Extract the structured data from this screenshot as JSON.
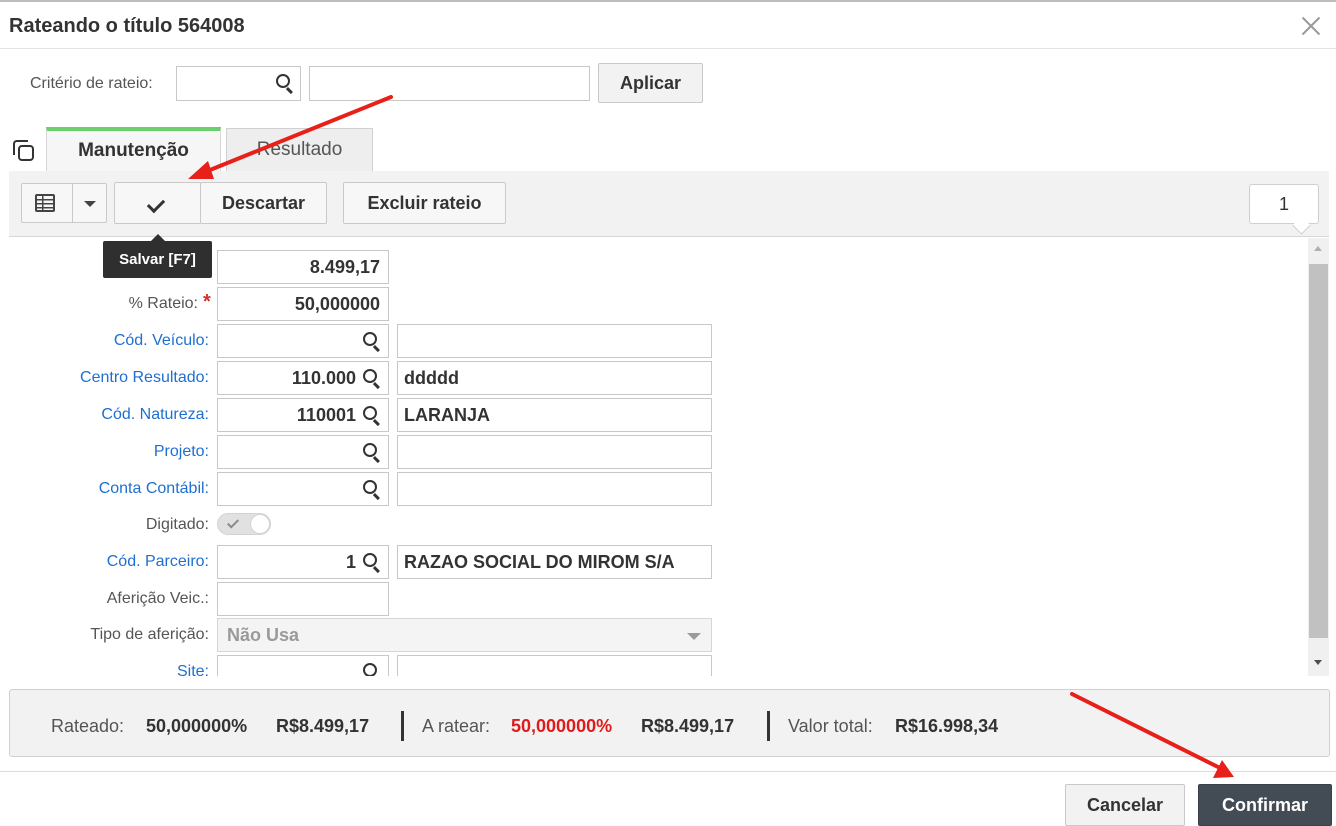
{
  "dialog": {
    "title": "Rateando o título 564008"
  },
  "criterio": {
    "label": "Critério de rateio:",
    "code_value": "",
    "desc_value": "",
    "apply_label": "Aplicar"
  },
  "tabs": [
    {
      "label": "Manutenção",
      "active": true
    },
    {
      "label": "Resultado",
      "active": false
    }
  ],
  "toolbar": {
    "descartar_label": "Descartar",
    "excluir_label": "Excluir rateio",
    "page_number": "1",
    "save_tooltip": "Salvar [F7]"
  },
  "form": {
    "valor_value": "8.499,17",
    "rateio": {
      "label": "% Rateio:",
      "value": "50,000000"
    },
    "veiculo": {
      "label": "Cód. Veículo:",
      "code": "",
      "desc": ""
    },
    "centro": {
      "label": "Centro Resultado:",
      "code": "110.000",
      "desc": "ddddd"
    },
    "natureza": {
      "label": "Cód. Natureza:",
      "code": "110001",
      "desc": "LARANJA"
    },
    "projeto": {
      "label": "Projeto:",
      "code": "",
      "desc": ""
    },
    "conta": {
      "label": "Conta Contábil:",
      "code": "",
      "desc": ""
    },
    "digitado": {
      "label": "Digitado:",
      "checked": true
    },
    "parceiro": {
      "label": "Cód. Parceiro:",
      "code": "1",
      "desc": "RAZAO SOCIAL DO MIROM S/A"
    },
    "afericao_veic": {
      "label": "Aferição Veic.:",
      "value": ""
    },
    "tipo_afericao": {
      "label": "Tipo de aferição:",
      "value": "Não Usa"
    },
    "site": {
      "label": "Site:",
      "code": "",
      "desc": ""
    }
  },
  "summary": {
    "rateado_label": "Rateado:",
    "rateado_pct": "50,000000%",
    "rateado_val": "R$8.499,17",
    "aratear_label": "A ratear:",
    "aratear_pct": "50,000000%",
    "aratear_val": "R$8.499,17",
    "total_label": "Valor total:",
    "total_val": "R$16.998,34"
  },
  "footer": {
    "cancel_label": "Cancelar",
    "confirm_label": "Confirmar"
  },
  "colors": {
    "accent_tab": "#6bcf6b",
    "link": "#1f6fd1",
    "negative": "#e01b1b",
    "confirm_bg": "#434b55",
    "annotation_arrow": "#e8201a"
  }
}
